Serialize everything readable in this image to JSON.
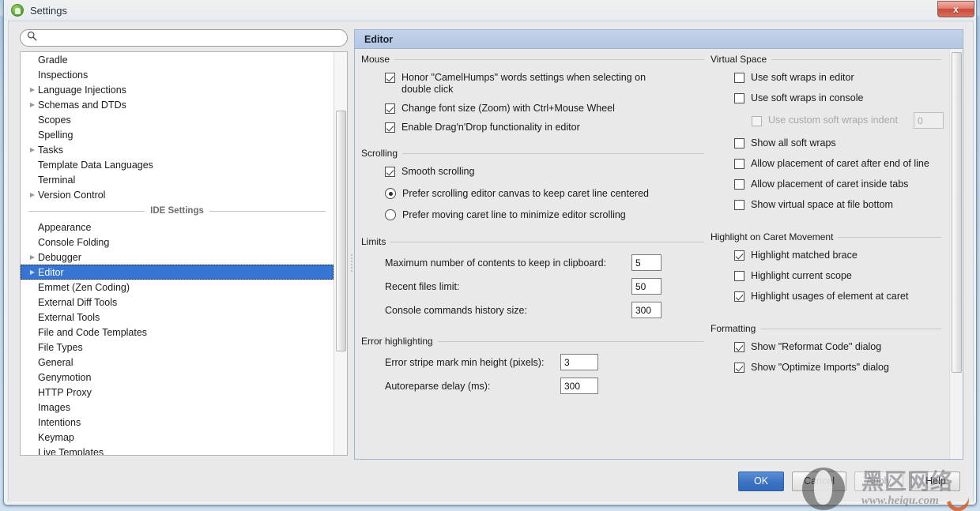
{
  "window": {
    "title": "Settings",
    "app_icon": "android-studio-icon",
    "close_label": "x"
  },
  "search": {
    "placeholder": "",
    "value": "",
    "icon": "search-icon"
  },
  "sidebar": {
    "section_label": "IDE Settings",
    "selected": "Editor",
    "project_items": [
      {
        "label": "Gradle",
        "expandable": false
      },
      {
        "label": "Inspections",
        "expandable": false
      },
      {
        "label": "Language Injections",
        "expandable": true
      },
      {
        "label": "Schemas and DTDs",
        "expandable": true
      },
      {
        "label": "Scopes",
        "expandable": false
      },
      {
        "label": "Spelling",
        "expandable": false
      },
      {
        "label": "Tasks",
        "expandable": true
      },
      {
        "label": "Template Data Languages",
        "expandable": false
      },
      {
        "label": "Terminal",
        "expandable": false
      },
      {
        "label": "Version Control",
        "expandable": true
      }
    ],
    "ide_items": [
      {
        "label": "Appearance",
        "expandable": false
      },
      {
        "label": "Console Folding",
        "expandable": false
      },
      {
        "label": "Debugger",
        "expandable": true
      },
      {
        "label": "Editor",
        "expandable": true,
        "selected": true
      },
      {
        "label": "Emmet (Zen Coding)",
        "expandable": false
      },
      {
        "label": "External Diff Tools",
        "expandable": false
      },
      {
        "label": "External Tools",
        "expandable": false
      },
      {
        "label": "File and Code Templates",
        "expandable": false
      },
      {
        "label": "File Types",
        "expandable": false
      },
      {
        "label": "General",
        "expandable": false
      },
      {
        "label": "Genymotion",
        "expandable": false
      },
      {
        "label": "HTTP Proxy",
        "expandable": false
      },
      {
        "label": "Images",
        "expandable": false
      },
      {
        "label": "Intentions",
        "expandable": false
      },
      {
        "label": "Keymap",
        "expandable": false
      },
      {
        "label": "Live Templates",
        "expandable": false
      }
    ]
  },
  "pane": {
    "header": "Editor",
    "groups": {
      "mouse": {
        "title": "Mouse",
        "options": [
          {
            "label": "Honor \"CamelHumps\" words settings when selecting on double click",
            "checked": true
          },
          {
            "label": "Change font size (Zoom) with Ctrl+Mouse Wheel",
            "checked": true
          },
          {
            "label": "Enable Drag'n'Drop functionality in editor",
            "checked": true
          }
        ]
      },
      "scrolling": {
        "title": "Scrolling",
        "checkbox": {
          "label": "Smooth scrolling",
          "checked": true
        },
        "radios": [
          {
            "label": "Prefer scrolling editor canvas to keep caret line centered",
            "selected": true
          },
          {
            "label": "Prefer moving caret line to minimize editor scrolling",
            "selected": false
          }
        ]
      },
      "limits": {
        "title": "Limits",
        "fields": [
          {
            "label": "Maximum number of contents to keep in clipboard:",
            "value": "5"
          },
          {
            "label": "Recent files limit:",
            "value": "50"
          },
          {
            "label": "Console commands history size:",
            "value": "300"
          }
        ]
      },
      "error_highlighting": {
        "title": "Error highlighting",
        "fields": [
          {
            "label": "Error stripe mark min height (pixels):",
            "value": "3"
          },
          {
            "label": "Autoreparse delay (ms):",
            "value": "300"
          }
        ]
      },
      "virtual_space": {
        "title": "Virtual Space",
        "options": [
          {
            "label": "Use soft wraps in editor",
            "checked": false
          },
          {
            "label": "Use soft wraps in console",
            "checked": false
          }
        ],
        "indent_option": {
          "label": "Use custom soft wraps indent",
          "checked": false,
          "disabled": true,
          "value": "0"
        },
        "options_rest": [
          {
            "label": "Show all soft wraps",
            "checked": false
          },
          {
            "label": "Allow placement of caret after end of line",
            "checked": false
          },
          {
            "label": "Allow placement of caret inside tabs",
            "checked": false
          },
          {
            "label": "Show virtual space at file bottom",
            "checked": false
          }
        ]
      },
      "highlight_caret": {
        "title": "Highlight on Caret Movement",
        "options": [
          {
            "label": "Highlight matched brace",
            "checked": true
          },
          {
            "label": "Highlight current scope",
            "checked": false
          },
          {
            "label": "Highlight usages of element at caret",
            "checked": true
          }
        ]
      },
      "formatting": {
        "title": "Formatting",
        "options": [
          {
            "label": "Show \"Reformat Code\" dialog",
            "checked": true
          },
          {
            "label": "Show \"Optimize Imports\" dialog",
            "checked": true
          }
        ]
      }
    }
  },
  "buttons": {
    "ok": "OK",
    "cancel": "Cancel",
    "apply": "Apply",
    "help": "Help"
  },
  "watermark": {
    "cn": "黑区网络",
    "url": "www.heiqu.com"
  },
  "colors": {
    "accent": "#3675d3",
    "primary_button": "#3a72c4",
    "header_gradient_top": "#c4d3ea",
    "header_gradient_bottom": "#b3c6e3",
    "close_button": "#c8493a"
  }
}
